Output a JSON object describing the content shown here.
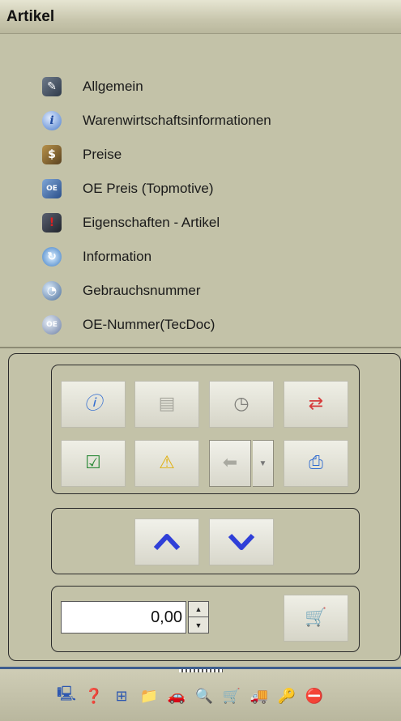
{
  "header": {
    "title": "Artikel"
  },
  "nav": {
    "items": [
      {
        "label": "Allgemein",
        "icon": "general-icon"
      },
      {
        "label": "Warenwirtschaftsinformationen",
        "icon": "info-icon"
      },
      {
        "label": "Preise",
        "icon": "price-tag-icon"
      },
      {
        "label": "OE Preis (Topmotive)",
        "icon": "oe-price-icon"
      },
      {
        "label": "Eigenschaften - Artikel",
        "icon": "properties-icon"
      },
      {
        "label": "Information",
        "icon": "information-icon"
      },
      {
        "label": "Gebrauchsnummer",
        "icon": "usage-number-icon"
      },
      {
        "label": "OE-Nummer(TecDoc)",
        "icon": "oe-number-icon"
      }
    ]
  },
  "toolbar": {
    "buttons": [
      {
        "icon": "info-icon",
        "enabled": true
      },
      {
        "icon": "document-icon",
        "enabled": false
      },
      {
        "icon": "clock-icon",
        "enabled": true
      },
      {
        "icon": "swap-icon",
        "enabled": true
      },
      {
        "icon": "checklist-icon",
        "enabled": true
      },
      {
        "icon": "warning-icon",
        "enabled": true
      },
      {
        "icon": "back-arrow-icon",
        "enabled": false
      },
      {
        "icon": "print-icon",
        "enabled": true
      }
    ],
    "nav_up_icon": "chevron-up-icon",
    "nav_down_icon": "chevron-down-icon"
  },
  "quantity": {
    "value": "0,00"
  },
  "bottom_bar": {
    "icons": [
      "user-icon",
      "help-icon",
      "network-icon",
      "folder-icon",
      "car-icon",
      "search-icon",
      "cart-icon",
      "truck-icon",
      "car-key-icon",
      "stop-search-icon"
    ]
  },
  "colors": {
    "panel": "#c3c2a8",
    "accent_border": "#3d5d8e",
    "chevron": "#2f3fd8"
  }
}
